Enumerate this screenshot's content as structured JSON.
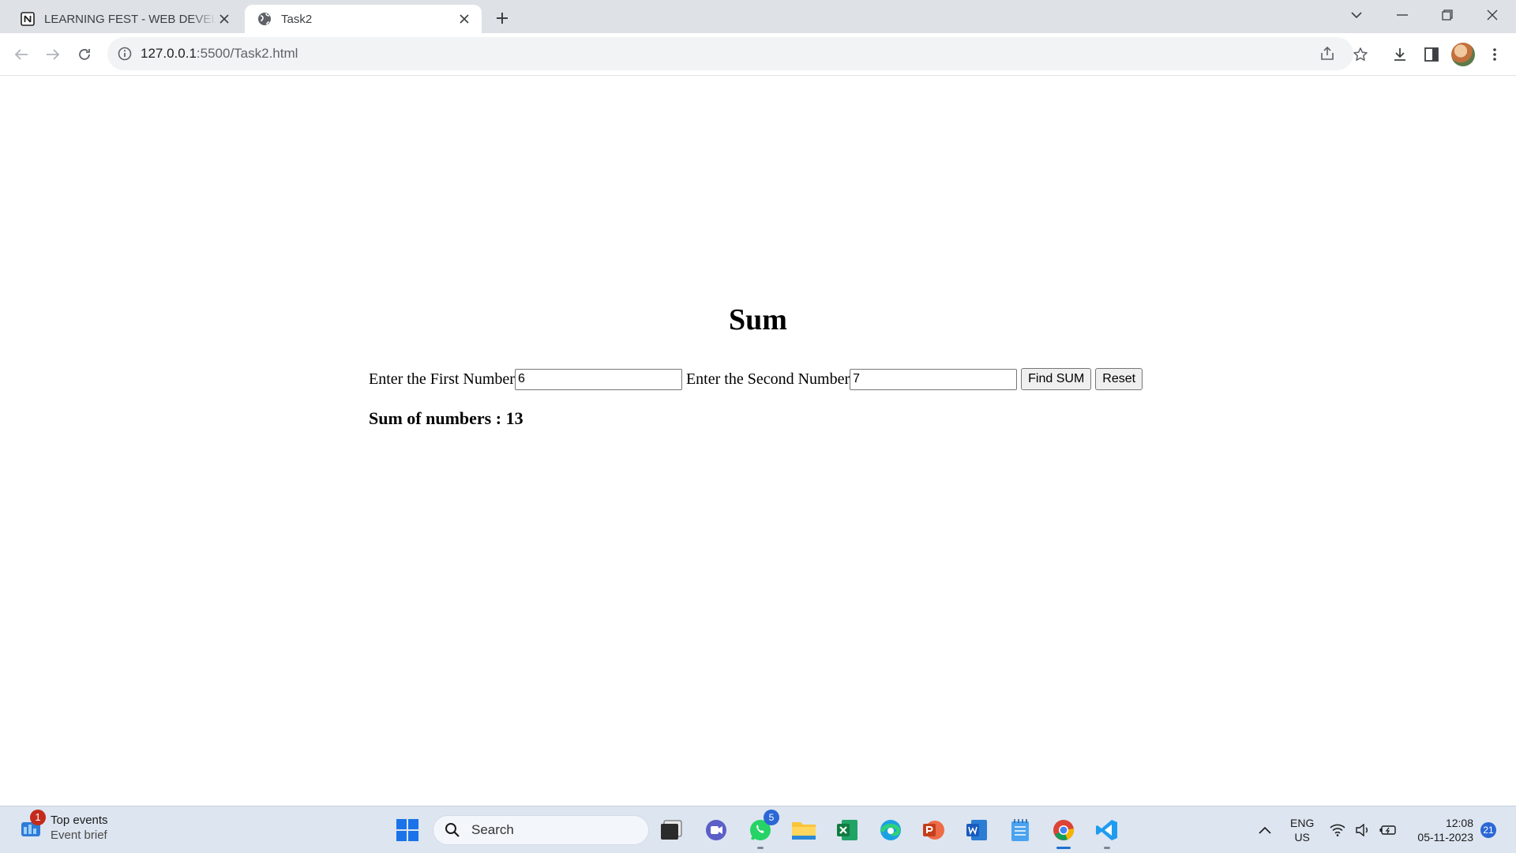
{
  "browser": {
    "tabs": [
      {
        "title": "LEARNING FEST - WEB DEVELOPER",
        "active": false,
        "favicon": "notion-icon"
      },
      {
        "title": "Task2",
        "active": true,
        "favicon": "globe-icon"
      }
    ],
    "address": {
      "host": "127.0.0.1",
      "path": ":5500/Task2.html"
    }
  },
  "page": {
    "heading": "Sum",
    "first_label": "Enter the First Number",
    "first_value": "6",
    "second_label": "Enter the Second Number",
    "second_value": "7",
    "find_button": "Find SUM",
    "reset_button": "Reset",
    "result": "Sum of numbers : 13"
  },
  "taskbar": {
    "widget": {
      "title": "Top events",
      "subtitle": "Event brief",
      "badge": "1"
    },
    "search_placeholder": "Search",
    "whatsapp_badge": "5",
    "lang_line1": "ENG",
    "lang_line2": "US",
    "time": "12:08",
    "date": "05-11-2023",
    "notifications": "21"
  }
}
